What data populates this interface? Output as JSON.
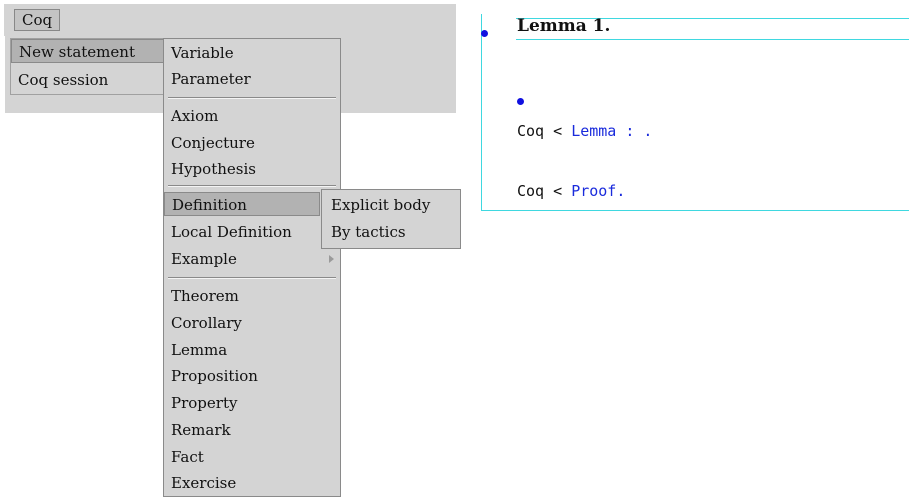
{
  "menubar": {
    "coq_label": "Coq"
  },
  "menu_level1": {
    "items": [
      {
        "label": "New statement"
      },
      {
        "label": "Coq session"
      }
    ]
  },
  "menu_level2": {
    "items": [
      {
        "label": "Variable"
      },
      {
        "label": "Parameter"
      },
      {
        "label": "Axiom"
      },
      {
        "label": "Conjecture"
      },
      {
        "label": "Hypothesis"
      },
      {
        "label": "Definition"
      },
      {
        "label": "Local Definition"
      },
      {
        "label": "Example"
      },
      {
        "label": "Theorem"
      },
      {
        "label": "Corollary"
      },
      {
        "label": "Lemma"
      },
      {
        "label": "Proposition"
      },
      {
        "label": "Property"
      },
      {
        "label": "Remark"
      },
      {
        "label": "Fact"
      },
      {
        "label": "Exercise"
      }
    ]
  },
  "menu_level3": {
    "items": [
      {
        "label": "Explicit body"
      },
      {
        "label": "By tactics"
      }
    ]
  },
  "editor": {
    "title": "Lemma 1.",
    "line1": {
      "prompt": "Coq < ",
      "code": "Lemma : ."
    },
    "line2": {
      "prompt": "Coq < ",
      "code": "Proof."
    }
  },
  "colors": {
    "accent_cyan": "#3fd8e0",
    "code_blue": "#1a2bdc",
    "menu_bg": "#d4d4d4",
    "menu_selected": "#b2b2b2"
  }
}
